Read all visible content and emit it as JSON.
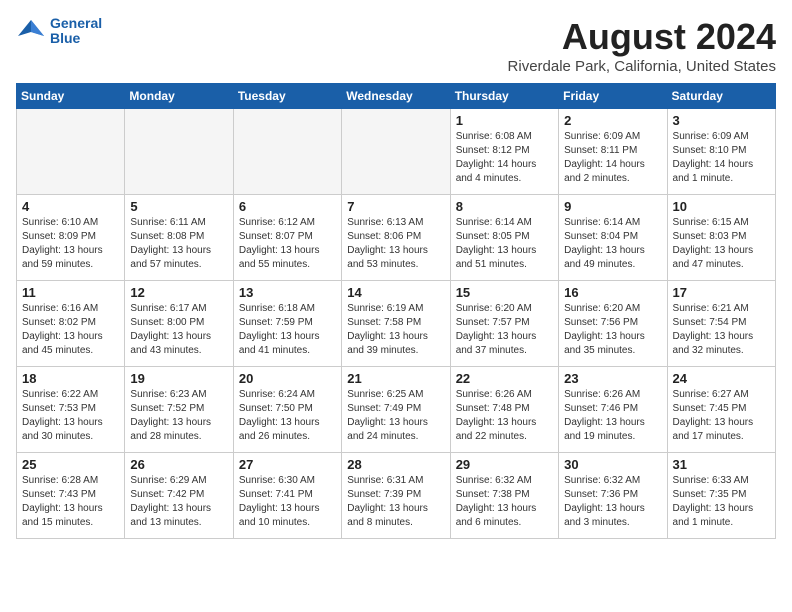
{
  "header": {
    "logo_line1": "General",
    "logo_line2": "Blue",
    "month_year": "August 2024",
    "location": "Riverdale Park, California, United States"
  },
  "days_of_week": [
    "Sunday",
    "Monday",
    "Tuesday",
    "Wednesday",
    "Thursday",
    "Friday",
    "Saturday"
  ],
  "weeks": [
    [
      {
        "day": "",
        "info": ""
      },
      {
        "day": "",
        "info": ""
      },
      {
        "day": "",
        "info": ""
      },
      {
        "day": "",
        "info": ""
      },
      {
        "day": "1",
        "info": "Sunrise: 6:08 AM\nSunset: 8:12 PM\nDaylight: 14 hours\nand 4 minutes."
      },
      {
        "day": "2",
        "info": "Sunrise: 6:09 AM\nSunset: 8:11 PM\nDaylight: 14 hours\nand 2 minutes."
      },
      {
        "day": "3",
        "info": "Sunrise: 6:09 AM\nSunset: 8:10 PM\nDaylight: 14 hours\nand 1 minute."
      }
    ],
    [
      {
        "day": "4",
        "info": "Sunrise: 6:10 AM\nSunset: 8:09 PM\nDaylight: 13 hours\nand 59 minutes."
      },
      {
        "day": "5",
        "info": "Sunrise: 6:11 AM\nSunset: 8:08 PM\nDaylight: 13 hours\nand 57 minutes."
      },
      {
        "day": "6",
        "info": "Sunrise: 6:12 AM\nSunset: 8:07 PM\nDaylight: 13 hours\nand 55 minutes."
      },
      {
        "day": "7",
        "info": "Sunrise: 6:13 AM\nSunset: 8:06 PM\nDaylight: 13 hours\nand 53 minutes."
      },
      {
        "day": "8",
        "info": "Sunrise: 6:14 AM\nSunset: 8:05 PM\nDaylight: 13 hours\nand 51 minutes."
      },
      {
        "day": "9",
        "info": "Sunrise: 6:14 AM\nSunset: 8:04 PM\nDaylight: 13 hours\nand 49 minutes."
      },
      {
        "day": "10",
        "info": "Sunrise: 6:15 AM\nSunset: 8:03 PM\nDaylight: 13 hours\nand 47 minutes."
      }
    ],
    [
      {
        "day": "11",
        "info": "Sunrise: 6:16 AM\nSunset: 8:02 PM\nDaylight: 13 hours\nand 45 minutes."
      },
      {
        "day": "12",
        "info": "Sunrise: 6:17 AM\nSunset: 8:00 PM\nDaylight: 13 hours\nand 43 minutes."
      },
      {
        "day": "13",
        "info": "Sunrise: 6:18 AM\nSunset: 7:59 PM\nDaylight: 13 hours\nand 41 minutes."
      },
      {
        "day": "14",
        "info": "Sunrise: 6:19 AM\nSunset: 7:58 PM\nDaylight: 13 hours\nand 39 minutes."
      },
      {
        "day": "15",
        "info": "Sunrise: 6:20 AM\nSunset: 7:57 PM\nDaylight: 13 hours\nand 37 minutes."
      },
      {
        "day": "16",
        "info": "Sunrise: 6:20 AM\nSunset: 7:56 PM\nDaylight: 13 hours\nand 35 minutes."
      },
      {
        "day": "17",
        "info": "Sunrise: 6:21 AM\nSunset: 7:54 PM\nDaylight: 13 hours\nand 32 minutes."
      }
    ],
    [
      {
        "day": "18",
        "info": "Sunrise: 6:22 AM\nSunset: 7:53 PM\nDaylight: 13 hours\nand 30 minutes."
      },
      {
        "day": "19",
        "info": "Sunrise: 6:23 AM\nSunset: 7:52 PM\nDaylight: 13 hours\nand 28 minutes."
      },
      {
        "day": "20",
        "info": "Sunrise: 6:24 AM\nSunset: 7:50 PM\nDaylight: 13 hours\nand 26 minutes."
      },
      {
        "day": "21",
        "info": "Sunrise: 6:25 AM\nSunset: 7:49 PM\nDaylight: 13 hours\nand 24 minutes."
      },
      {
        "day": "22",
        "info": "Sunrise: 6:26 AM\nSunset: 7:48 PM\nDaylight: 13 hours\nand 22 minutes."
      },
      {
        "day": "23",
        "info": "Sunrise: 6:26 AM\nSunset: 7:46 PM\nDaylight: 13 hours\nand 19 minutes."
      },
      {
        "day": "24",
        "info": "Sunrise: 6:27 AM\nSunset: 7:45 PM\nDaylight: 13 hours\nand 17 minutes."
      }
    ],
    [
      {
        "day": "25",
        "info": "Sunrise: 6:28 AM\nSunset: 7:43 PM\nDaylight: 13 hours\nand 15 minutes."
      },
      {
        "day": "26",
        "info": "Sunrise: 6:29 AM\nSunset: 7:42 PM\nDaylight: 13 hours\nand 13 minutes."
      },
      {
        "day": "27",
        "info": "Sunrise: 6:30 AM\nSunset: 7:41 PM\nDaylight: 13 hours\nand 10 minutes."
      },
      {
        "day": "28",
        "info": "Sunrise: 6:31 AM\nSunset: 7:39 PM\nDaylight: 13 hours\nand 8 minutes."
      },
      {
        "day": "29",
        "info": "Sunrise: 6:32 AM\nSunset: 7:38 PM\nDaylight: 13 hours\nand 6 minutes."
      },
      {
        "day": "30",
        "info": "Sunrise: 6:32 AM\nSunset: 7:36 PM\nDaylight: 13 hours\nand 3 minutes."
      },
      {
        "day": "31",
        "info": "Sunrise: 6:33 AM\nSunset: 7:35 PM\nDaylight: 13 hours\nand 1 minute."
      }
    ]
  ]
}
